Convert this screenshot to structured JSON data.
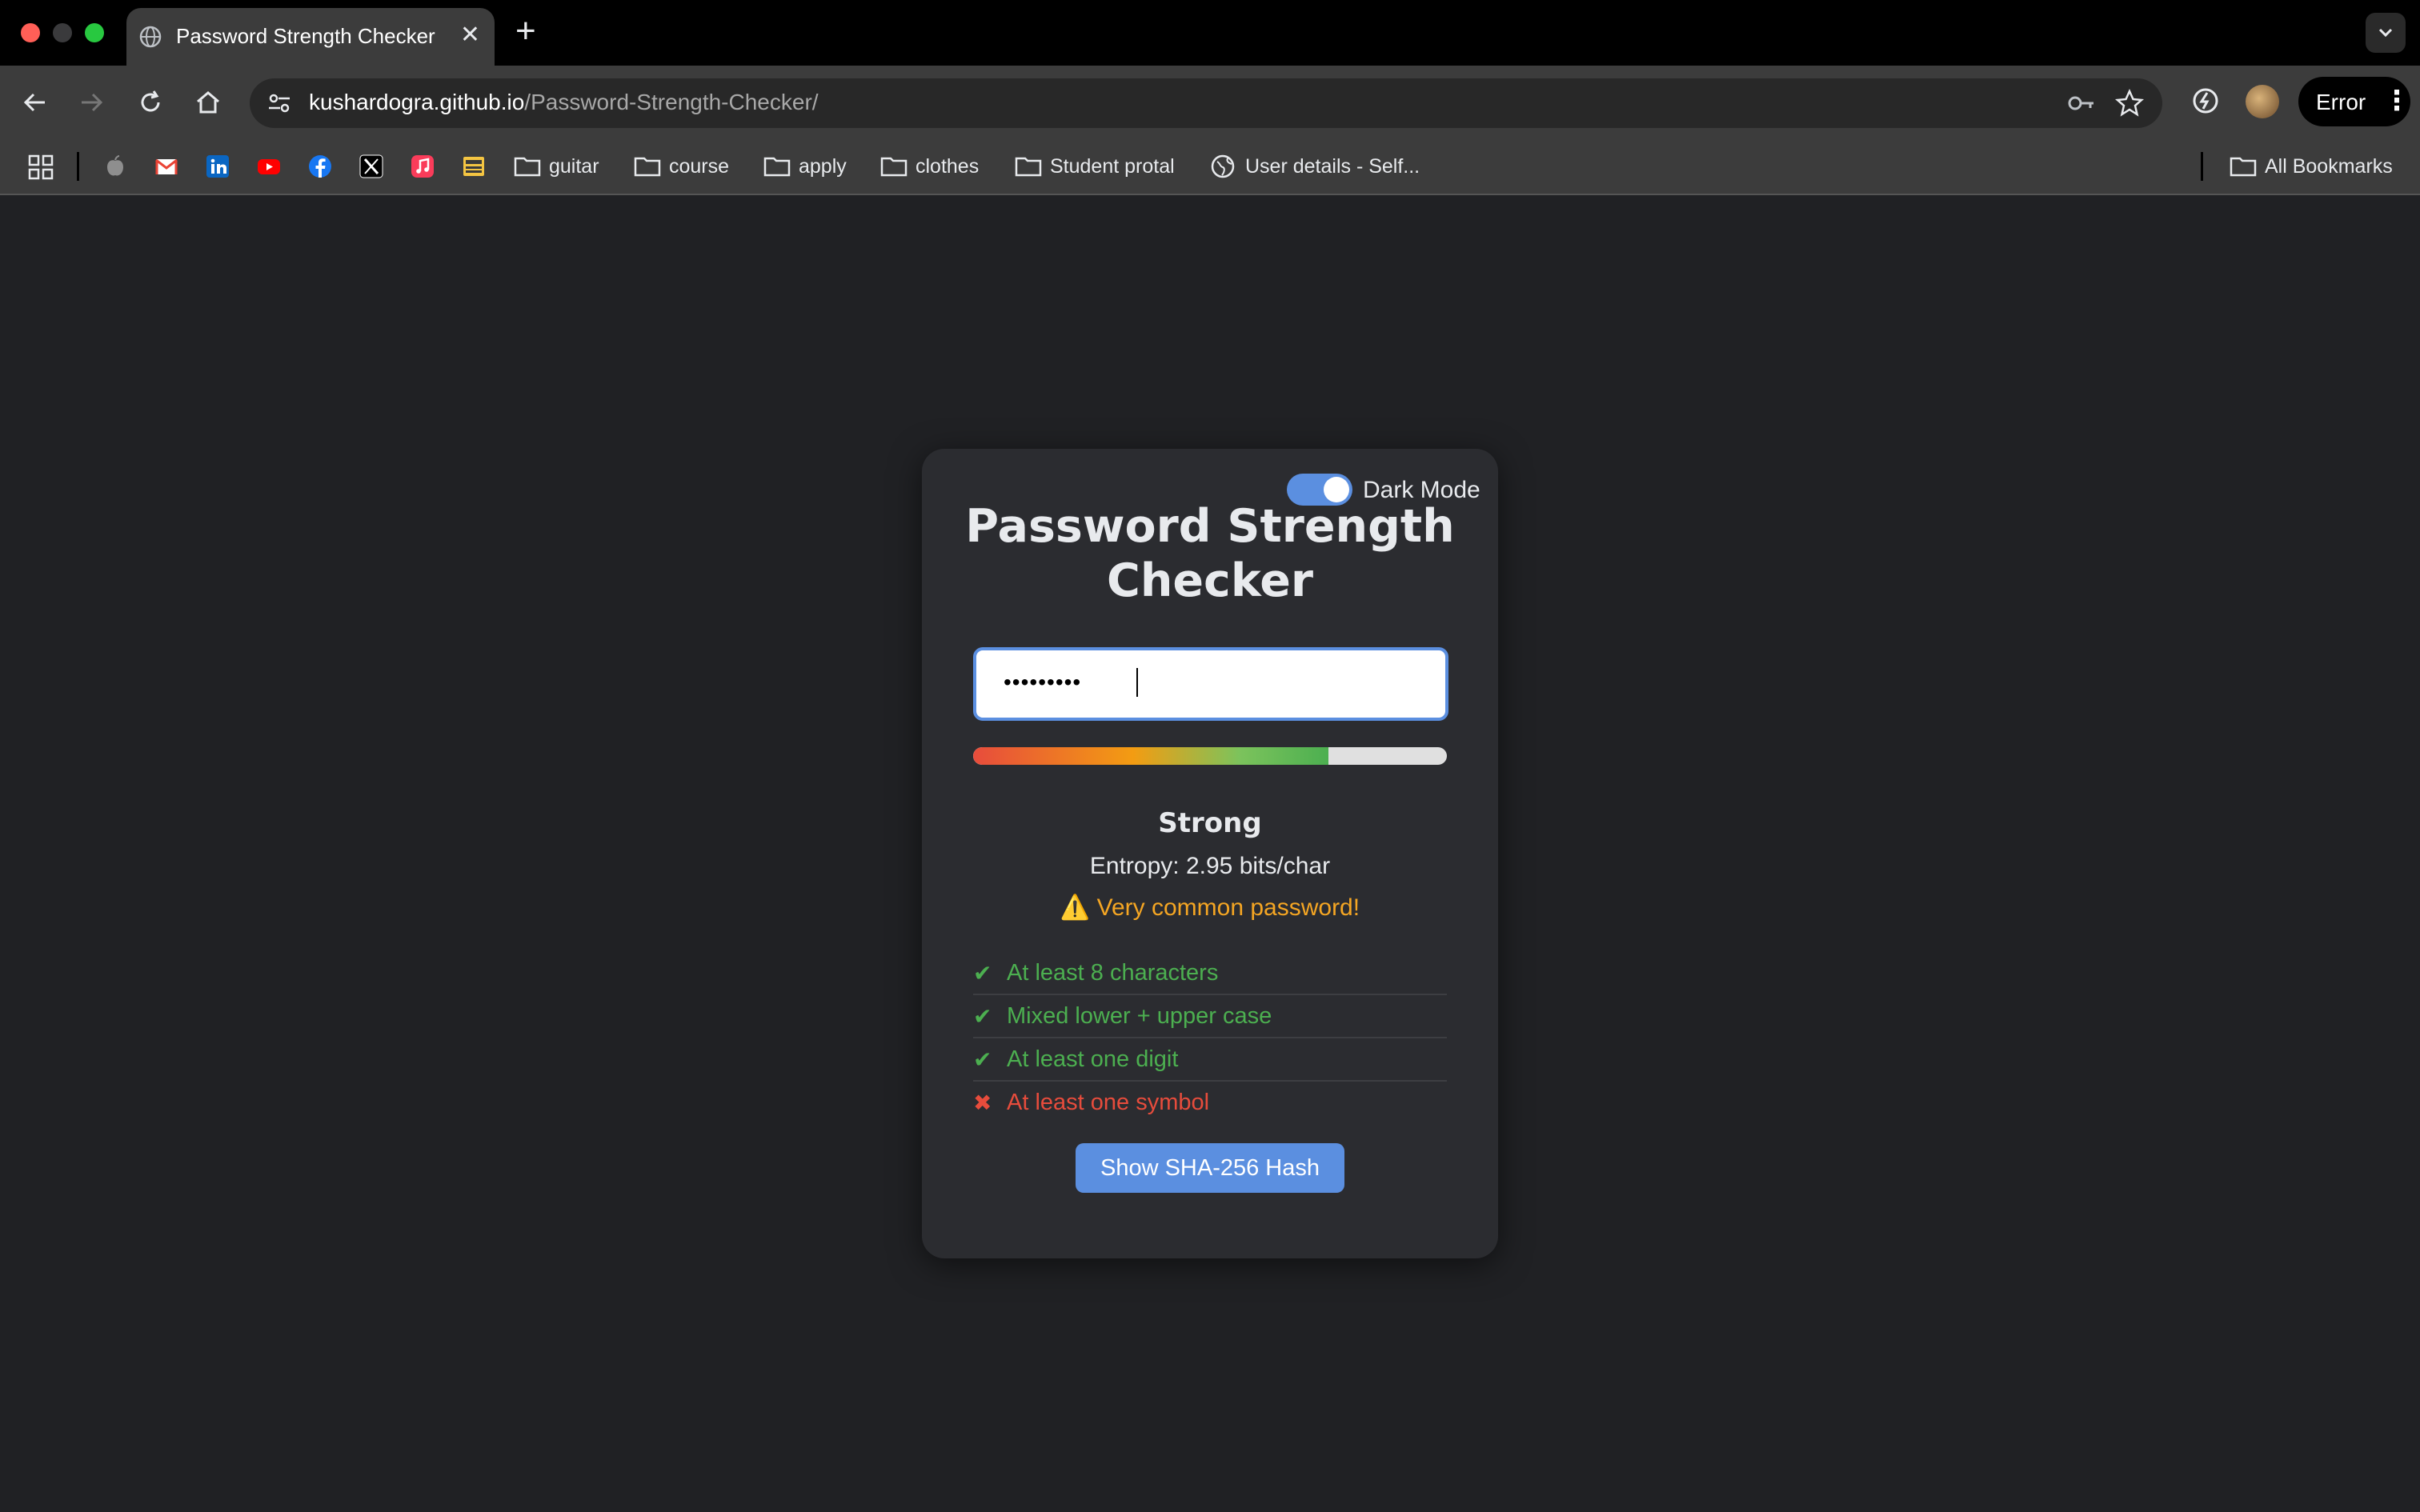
{
  "browser": {
    "tab_title": "Password Strength Checker",
    "url_host": "kushardogra.github.io",
    "url_path": "/Password-Strength-Checker/",
    "profile_button_label": "Error",
    "bookmarks": [
      {
        "label": "guitar"
      },
      {
        "label": "course"
      },
      {
        "label": "apply"
      },
      {
        "label": "clothes"
      },
      {
        "label": "Student protal"
      },
      {
        "label": "User details - Self..."
      }
    ],
    "all_bookmarks_label": "All Bookmarks"
  },
  "app": {
    "dark_mode_label": "Dark Mode",
    "dark_mode_on": true,
    "title": "Password Strength Checker",
    "password_masked": "•••••••••",
    "strength_meter_fraction": 0.75,
    "strength_label": "Strong",
    "entropy_text": "Entropy: 2.95 bits/char",
    "warning_text": "⚠️ Very common password!",
    "rules": [
      {
        "mark": "✔",
        "label": "At least 8 characters",
        "status": "ok"
      },
      {
        "mark": "✔",
        "label": "Mixed lower + upper case",
        "status": "ok"
      },
      {
        "mark": "✔",
        "label": "At least one digit",
        "status": "ok"
      },
      {
        "mark": "✖",
        "label": "At least one symbol",
        "status": "bad"
      }
    ],
    "hash_button_label": "Show SHA-256 Hash"
  },
  "colors": {
    "accent": "#5b8fe0",
    "ok": "#4caf50",
    "bad": "#e74c3c",
    "warning": "#f5a623",
    "page_bg": "#202124",
    "card_bg": "#2b2c30"
  }
}
